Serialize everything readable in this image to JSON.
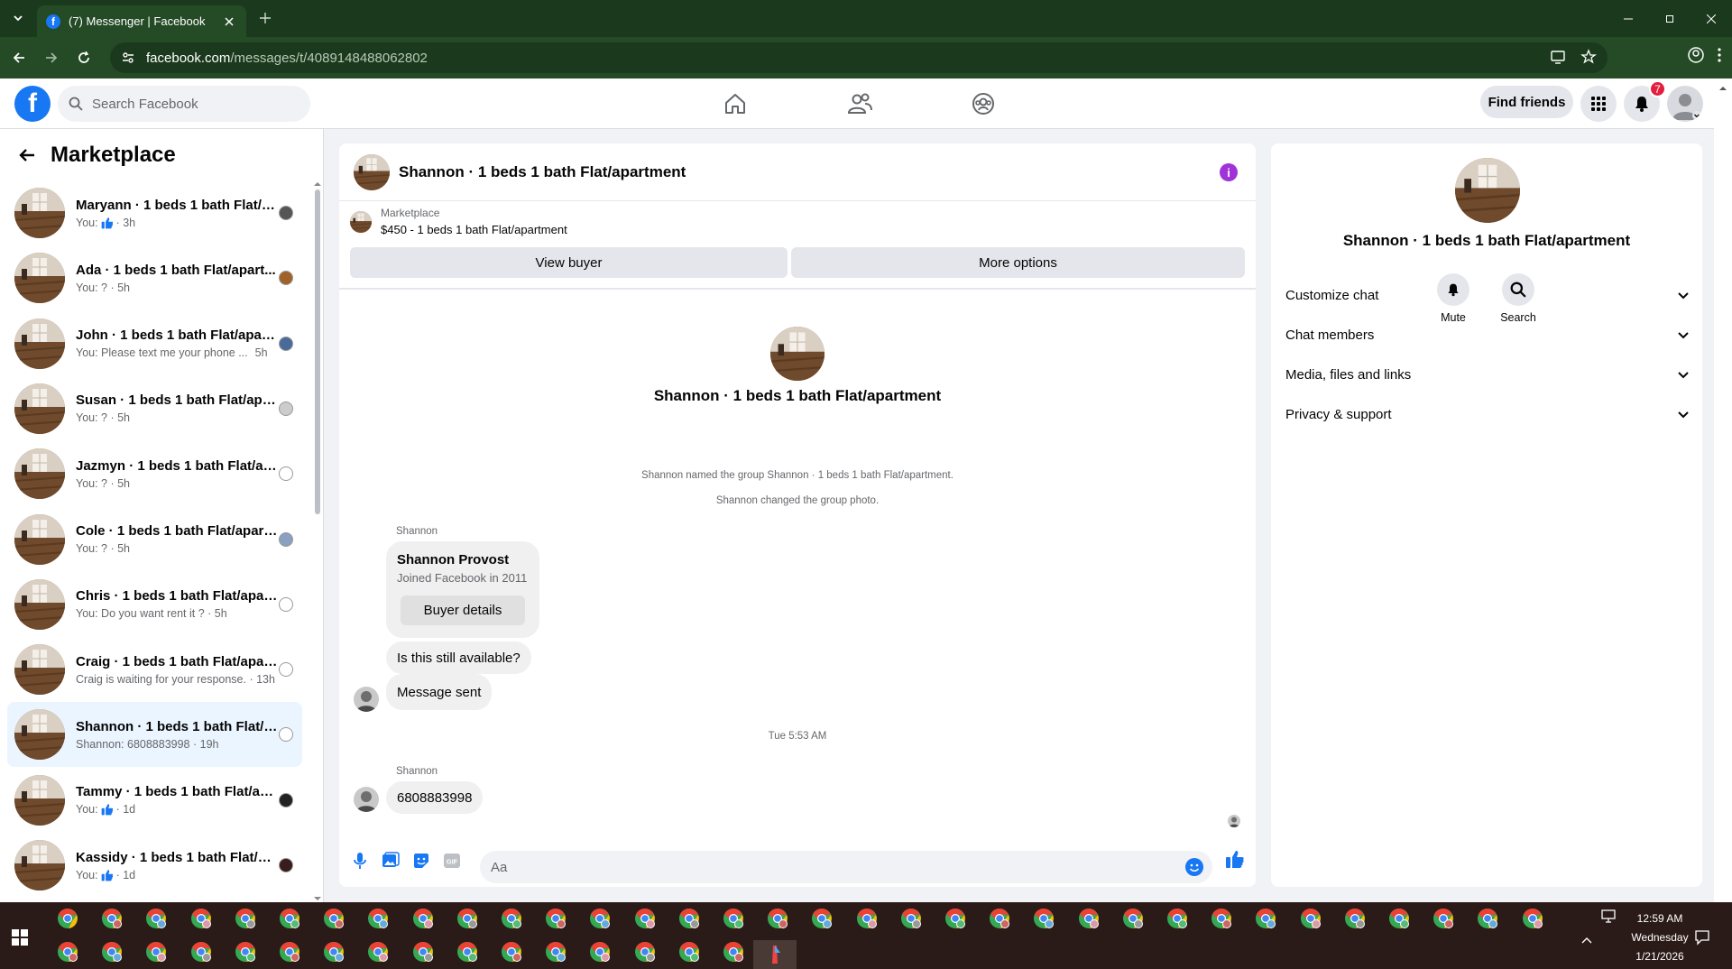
{
  "browser": {
    "tab_title": "(7) Messenger | Facebook",
    "url_host": "facebook.com",
    "url_path": "/messages/t/4089148488062802"
  },
  "fb": {
    "search_placeholder": "Search Facebook",
    "find_friends": "Find friends",
    "notification_count": "7",
    "logo_letter": "f"
  },
  "left": {
    "title": "Marketplace",
    "conversations": [
      {
        "name": "Maryann · 1 beds 1 bath Flat/a...",
        "preview": "You:",
        "like": true,
        "time": "· 3h"
      },
      {
        "name": "Ada · 1 beds 1 bath Flat/apart...",
        "preview": "You: ? · 5h",
        "like": false,
        "time": ""
      },
      {
        "name": "John · 1 beds 1 bath Flat/apart...",
        "preview": "You: Please text me your phone ...",
        "like": false,
        "time": "5h"
      },
      {
        "name": "Susan · 1 beds 1 bath Flat/apa...",
        "preview": "You: ? · 5h",
        "like": false,
        "time": ""
      },
      {
        "name": "Jazmyn · 1 beds 1 bath Flat/apar...",
        "preview": "You: ? · 5h",
        "like": false,
        "time": ""
      },
      {
        "name": "Cole · 1 beds 1 bath Flat/apart...",
        "preview": "You: ? · 5h",
        "like": false,
        "time": ""
      },
      {
        "name": "Chris · 1 beds 1 bath Flat/apartm...",
        "preview": "You: Do you want rent it ? · 5h",
        "like": false,
        "time": ""
      },
      {
        "name": "Craig · 1 beds 1 bath Flat/apartm...",
        "preview": "Craig is waiting for your response. · 13h",
        "like": false,
        "time": ""
      },
      {
        "name": "Shannon · 1 beds 1 bath Flat/apa...",
        "preview": "Shannon: 6808883998 · 19h",
        "like": false,
        "time": ""
      },
      {
        "name": "Tammy · 1 beds 1 bath Flat/ap...",
        "preview": "You:",
        "like": true,
        "time": "· 1d"
      },
      {
        "name": "Kassidy · 1 beds 1 bath Flat/ap...",
        "preview": "You:",
        "like": true,
        "time": "· 1d"
      }
    ]
  },
  "chat": {
    "title": "Shannon · 1 beds 1 bath Flat/apartment",
    "info_glyph": "i",
    "marketplace_label": "Marketplace",
    "listing": "$450 - 1 beds 1 bath Flat/apartment",
    "view_buyer": "View buyer",
    "more_options": "More options",
    "group_name": "Shannon · 1 beds 1 bath Flat/apartment",
    "sys1": "Shannon named the group Shannon · 1 beds 1 bath Flat/apartment.",
    "sys2": "Shannon changed the group photo.",
    "sender1": "Shannon",
    "card_name": "Shannon Provost",
    "card_joined": "Joined Facebook in 2011",
    "buyer_details": "Buyer details",
    "msg1": "Is this still available?",
    "msg2": "Message sent",
    "timestamp": "Tue 5:53 AM",
    "sender2": "Shannon",
    "msg3": "6808883998",
    "composer_placeholder": "Aa",
    "gif_label": "GIF"
  },
  "right": {
    "name": "Shannon · 1 beds 1 bath Flat/apartment",
    "mute": "Mute",
    "search": "Search",
    "sections": [
      "Customize chat",
      "Chat members",
      "Media, files and links",
      "Privacy & support"
    ]
  },
  "taskbar": {
    "time": "12:59 AM",
    "day": "Wednesday",
    "date": "1/21/2026"
  }
}
